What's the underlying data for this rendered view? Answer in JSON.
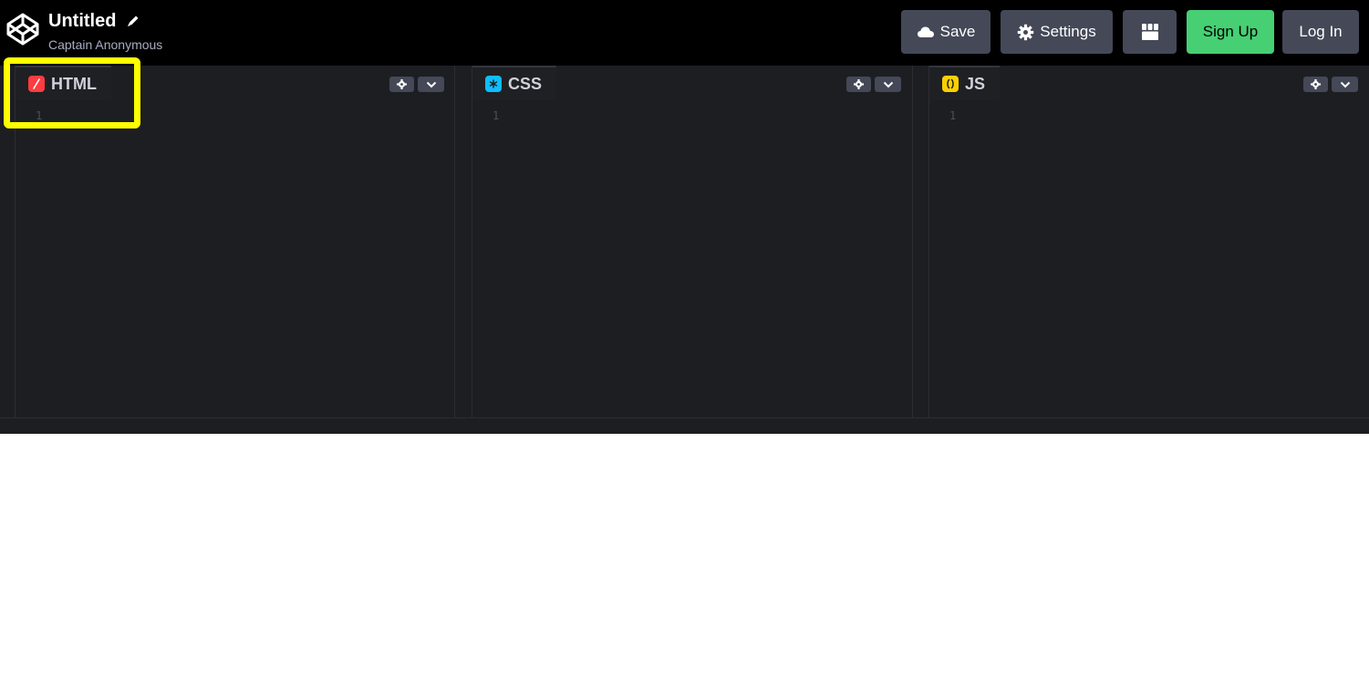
{
  "header": {
    "title": "Untitled",
    "author": "Captain Anonymous",
    "buttons": {
      "save": "Save",
      "settings": "Settings",
      "signup": "Sign Up",
      "login": "Log In"
    }
  },
  "editors": [
    {
      "label": "HTML",
      "icon": "html-icon",
      "icon_color": "#ff3c41",
      "line": "1"
    },
    {
      "label": "CSS",
      "icon": "css-icon",
      "icon_color": "#0ebeff",
      "line": "1"
    },
    {
      "label": "JS",
      "icon": "js-icon",
      "icon_color": "#fcd000",
      "line": "1"
    }
  ],
  "colors": {
    "topbar": "#000000",
    "editor_bg": "#1d1e22",
    "button_bg": "#444857",
    "signup_bg": "#47cf73",
    "highlight": "#ffff00"
  }
}
